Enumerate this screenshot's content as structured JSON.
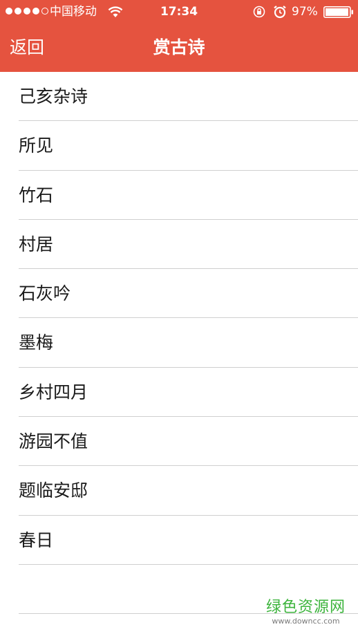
{
  "status_bar": {
    "signal_dots": 5,
    "signal_filled": 4,
    "carrier": "中国移动",
    "time": "17:34",
    "battery_percent": "97%",
    "battery_level": 0.97
  },
  "nav": {
    "back_label": "返回",
    "title": "赏古诗"
  },
  "poems": [
    "己亥杂诗",
    "所见",
    "竹石",
    "村居",
    "石灰吟",
    "墨梅",
    "乡村四月",
    "游园不值",
    "题临安邸",
    "春日"
  ],
  "watermark": {
    "main": "绿色资源网",
    "sub": "www.downcc.com"
  },
  "colors": {
    "header": "#e5533f",
    "watermark": "#3cb43c"
  }
}
